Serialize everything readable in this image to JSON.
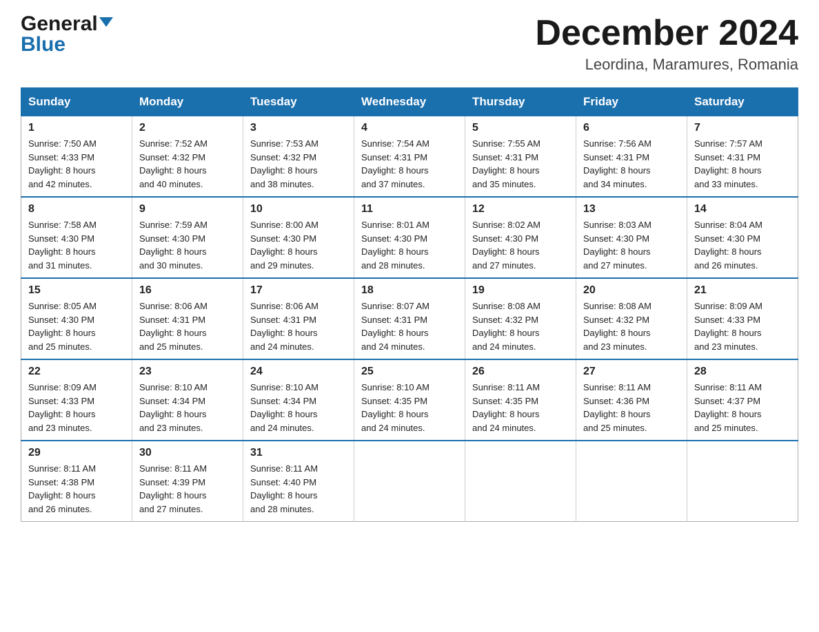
{
  "header": {
    "logo_line1": "General",
    "logo_line2": "Blue",
    "month_title": "December 2024",
    "location": "Leordina, Maramures, Romania"
  },
  "weekdays": [
    "Sunday",
    "Monday",
    "Tuesday",
    "Wednesday",
    "Thursday",
    "Friday",
    "Saturday"
  ],
  "weeks": [
    [
      {
        "day": "1",
        "sunrise": "7:50 AM",
        "sunset": "4:33 PM",
        "daylight": "8 hours and 42 minutes."
      },
      {
        "day": "2",
        "sunrise": "7:52 AM",
        "sunset": "4:32 PM",
        "daylight": "8 hours and 40 minutes."
      },
      {
        "day": "3",
        "sunrise": "7:53 AM",
        "sunset": "4:32 PM",
        "daylight": "8 hours and 38 minutes."
      },
      {
        "day": "4",
        "sunrise": "7:54 AM",
        "sunset": "4:31 PM",
        "daylight": "8 hours and 37 minutes."
      },
      {
        "day": "5",
        "sunrise": "7:55 AM",
        "sunset": "4:31 PM",
        "daylight": "8 hours and 35 minutes."
      },
      {
        "day": "6",
        "sunrise": "7:56 AM",
        "sunset": "4:31 PM",
        "daylight": "8 hours and 34 minutes."
      },
      {
        "day": "7",
        "sunrise": "7:57 AM",
        "sunset": "4:31 PM",
        "daylight": "8 hours and 33 minutes."
      }
    ],
    [
      {
        "day": "8",
        "sunrise": "7:58 AM",
        "sunset": "4:30 PM",
        "daylight": "8 hours and 31 minutes."
      },
      {
        "day": "9",
        "sunrise": "7:59 AM",
        "sunset": "4:30 PM",
        "daylight": "8 hours and 30 minutes."
      },
      {
        "day": "10",
        "sunrise": "8:00 AM",
        "sunset": "4:30 PM",
        "daylight": "8 hours and 29 minutes."
      },
      {
        "day": "11",
        "sunrise": "8:01 AM",
        "sunset": "4:30 PM",
        "daylight": "8 hours and 28 minutes."
      },
      {
        "day": "12",
        "sunrise": "8:02 AM",
        "sunset": "4:30 PM",
        "daylight": "8 hours and 27 minutes."
      },
      {
        "day": "13",
        "sunrise": "8:03 AM",
        "sunset": "4:30 PM",
        "daylight": "8 hours and 27 minutes."
      },
      {
        "day": "14",
        "sunrise": "8:04 AM",
        "sunset": "4:30 PM",
        "daylight": "8 hours and 26 minutes."
      }
    ],
    [
      {
        "day": "15",
        "sunrise": "8:05 AM",
        "sunset": "4:30 PM",
        "daylight": "8 hours and 25 minutes."
      },
      {
        "day": "16",
        "sunrise": "8:06 AM",
        "sunset": "4:31 PM",
        "daylight": "8 hours and 25 minutes."
      },
      {
        "day": "17",
        "sunrise": "8:06 AM",
        "sunset": "4:31 PM",
        "daylight": "8 hours and 24 minutes."
      },
      {
        "day": "18",
        "sunrise": "8:07 AM",
        "sunset": "4:31 PM",
        "daylight": "8 hours and 24 minutes."
      },
      {
        "day": "19",
        "sunrise": "8:08 AM",
        "sunset": "4:32 PM",
        "daylight": "8 hours and 24 minutes."
      },
      {
        "day": "20",
        "sunrise": "8:08 AM",
        "sunset": "4:32 PM",
        "daylight": "8 hours and 23 minutes."
      },
      {
        "day": "21",
        "sunrise": "8:09 AM",
        "sunset": "4:33 PM",
        "daylight": "8 hours and 23 minutes."
      }
    ],
    [
      {
        "day": "22",
        "sunrise": "8:09 AM",
        "sunset": "4:33 PM",
        "daylight": "8 hours and 23 minutes."
      },
      {
        "day": "23",
        "sunrise": "8:10 AM",
        "sunset": "4:34 PM",
        "daylight": "8 hours and 23 minutes."
      },
      {
        "day": "24",
        "sunrise": "8:10 AM",
        "sunset": "4:34 PM",
        "daylight": "8 hours and 24 minutes."
      },
      {
        "day": "25",
        "sunrise": "8:10 AM",
        "sunset": "4:35 PM",
        "daylight": "8 hours and 24 minutes."
      },
      {
        "day": "26",
        "sunrise": "8:11 AM",
        "sunset": "4:35 PM",
        "daylight": "8 hours and 24 minutes."
      },
      {
        "day": "27",
        "sunrise": "8:11 AM",
        "sunset": "4:36 PM",
        "daylight": "8 hours and 25 minutes."
      },
      {
        "day": "28",
        "sunrise": "8:11 AM",
        "sunset": "4:37 PM",
        "daylight": "8 hours and 25 minutes."
      }
    ],
    [
      {
        "day": "29",
        "sunrise": "8:11 AM",
        "sunset": "4:38 PM",
        "daylight": "8 hours and 26 minutes."
      },
      {
        "day": "30",
        "sunrise": "8:11 AM",
        "sunset": "4:39 PM",
        "daylight": "8 hours and 27 minutes."
      },
      {
        "day": "31",
        "sunrise": "8:11 AM",
        "sunset": "4:40 PM",
        "daylight": "8 hours and 28 minutes."
      },
      null,
      null,
      null,
      null
    ]
  ],
  "labels": {
    "sunrise": "Sunrise:",
    "sunset": "Sunset:",
    "daylight": "Daylight:"
  }
}
